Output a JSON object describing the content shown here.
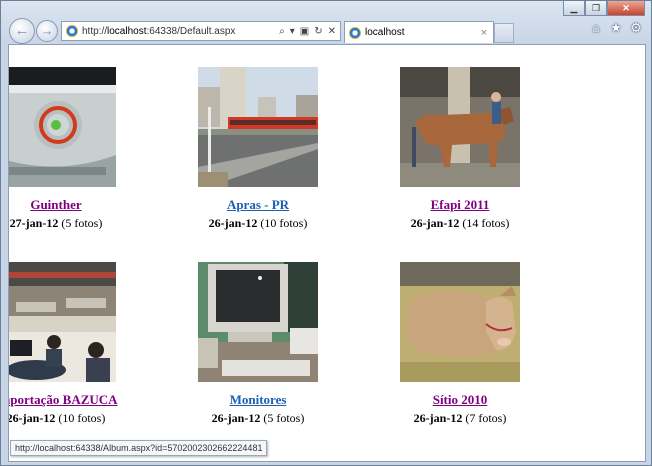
{
  "browser": {
    "address": {
      "prefix": "http://",
      "host": "localhost",
      "rest": ":64338/Default.aspx"
    },
    "tab_title": "localhost",
    "back_icon": "back-arrow-icon",
    "forward_icon": "forward-arrow-icon",
    "tab_close": "×",
    "status_url": "http://localhost:64338/Album.aspx?id=5702002302662224481"
  },
  "albums": [
    {
      "title": "Guinther",
      "date": "27-jan-12",
      "count": "(5 fotos)",
      "active": false,
      "thumb": "xbox-console-red-ring"
    },
    {
      "title": "Apras - PR",
      "date": "26-jan-12",
      "count": "(10 fotos)",
      "active": true,
      "thumb": "city-street-red-bus"
    },
    {
      "title": "Efapi 2011",
      "date": "26-jan-12",
      "count": "(14 fotos)",
      "active": false,
      "thumb": "cow-at-fair"
    },
    {
      "title": "Importação BAZUCA",
      "date": "26-jan-12",
      "count": "(10 fotos)",
      "active": false,
      "thumb": "store-checkout-people"
    },
    {
      "title": "Monitores",
      "date": "26-jan-12",
      "count": "(5 fotos)",
      "active": true,
      "thumb": "crt-monitor-keyboard"
    },
    {
      "title": "Sítio 2010",
      "date": "26-jan-12",
      "count": "(7 fotos)",
      "active": false,
      "thumb": "calf-lying-hay"
    }
  ]
}
